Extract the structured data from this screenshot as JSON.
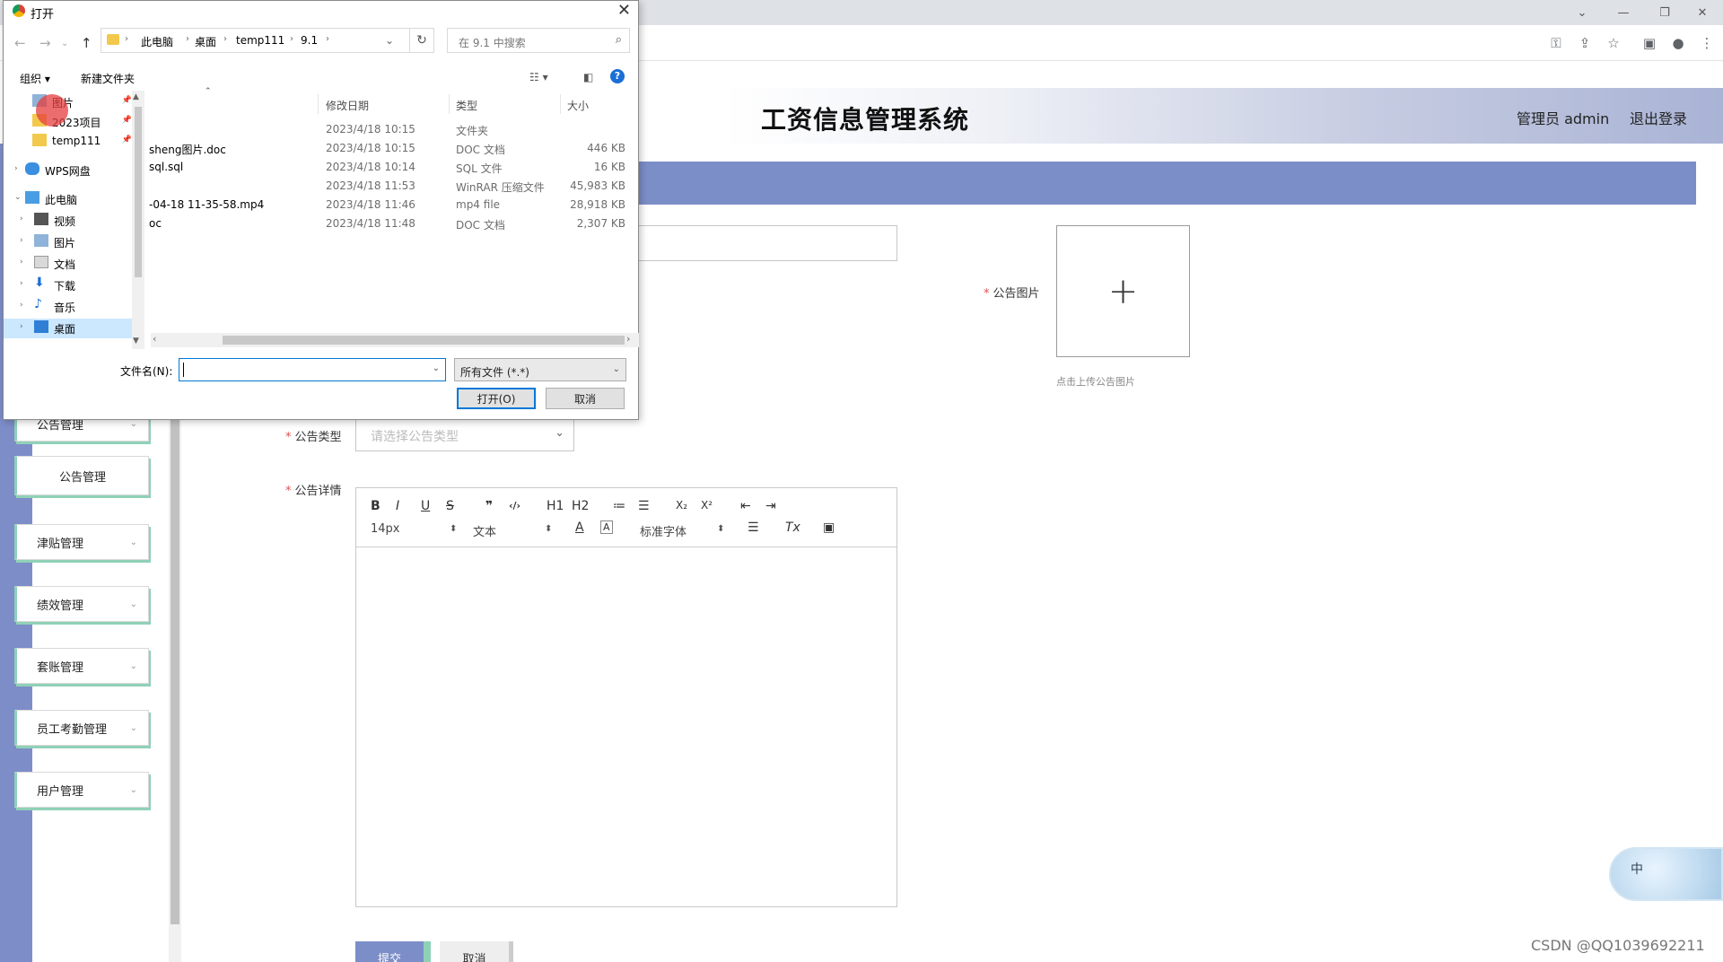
{
  "browser": {
    "min_icon": "minimize-icon",
    "restore_icon": "restore-icon",
    "close_icon": "close-icon",
    "toolbar_icons": [
      "key-icon",
      "share-icon",
      "star-icon",
      "sidebar-icon",
      "profile-icon",
      "menu-icon"
    ]
  },
  "header": {
    "title": "工资信息管理系统",
    "admin": "管理员 admin",
    "logout": "退出登录"
  },
  "sidebar": {
    "items": [
      {
        "label": "公告管理"
      },
      {
        "label": "津贴管理"
      },
      {
        "label": "绩效管理"
      },
      {
        "label": "套账管理"
      },
      {
        "label": "员工考勤管理"
      },
      {
        "label": "用户管理"
      }
    ],
    "submenu": "公告管理"
  },
  "form": {
    "notice_image_label": "公告图片",
    "upload_plus": "+",
    "upload_hint": "点击上传公告图片",
    "notice_type_label": "公告类型",
    "notice_type_placeholder": "请选择公告类型",
    "notice_detail_label": "公告详情",
    "submit": "提交",
    "cancel": "取消"
  },
  "editor": {
    "buttons": [
      "B",
      "I",
      "U",
      "S",
      "❞",
      "‹/›",
      "H1",
      "H2",
      "≔",
      "☰",
      "X₂",
      "X²",
      "⇤",
      "⇥"
    ],
    "font_size": "14px",
    "block_type": "文本",
    "font_family": "标准字体",
    "color_btn": "A",
    "bg_btn": "A",
    "align_icon": "align-icon",
    "clear_format": "Tx",
    "image_icon": "image-icon"
  },
  "dialog": {
    "title": "打开",
    "breadcrumb": [
      "此电脑",
      "桌面",
      "temp111",
      "9.1"
    ],
    "search_placeholder": "在 9.1 中搜索",
    "organize": "组织 ▾",
    "new_folder": "新建文件夹",
    "nav": [
      {
        "label": "图片",
        "pinned": true
      },
      {
        "label": "2023项目",
        "pinned": true
      },
      {
        "label": "temp111",
        "pinned": true
      },
      {
        "label": "WPS网盘"
      },
      {
        "label": "此电脑"
      },
      {
        "label": "视频"
      },
      {
        "label": "图片"
      },
      {
        "label": "文档"
      },
      {
        "label": "下载"
      },
      {
        "label": "音乐"
      },
      {
        "label": "桌面"
      }
    ],
    "columns": [
      "修改日期",
      "类型",
      "大小"
    ],
    "files": [
      {
        "name": "",
        "date": "2023/4/18 10:15",
        "type": "文件夹",
        "size": ""
      },
      {
        "name": "sheng图片.doc",
        "date": "2023/4/18 10:15",
        "type": "DOC 文档",
        "size": "446 KB"
      },
      {
        "name": "sql.sql",
        "date": "2023/4/18 10:14",
        "type": "SQL 文件",
        "size": "16 KB"
      },
      {
        "name": "",
        "date": "2023/4/18 11:53",
        "type": "WinRAR 压缩文件",
        "size": "45,983 KB"
      },
      {
        "name": "-04-18 11-35-58.mp4",
        "date": "2023/4/18 11:46",
        "type": "mp4 file",
        "size": "28,918 KB"
      },
      {
        "name": "oc",
        "date": "2023/4/18 11:48",
        "type": "DOC 文档",
        "size": "2,307 KB"
      }
    ],
    "filename_label": "文件名(N):",
    "filter": "所有文件 (*.*)",
    "open": "打开(O)",
    "cancel": "取消"
  },
  "widget": {
    "text": "中"
  },
  "watermark": "CSDN @QQ1039692211"
}
